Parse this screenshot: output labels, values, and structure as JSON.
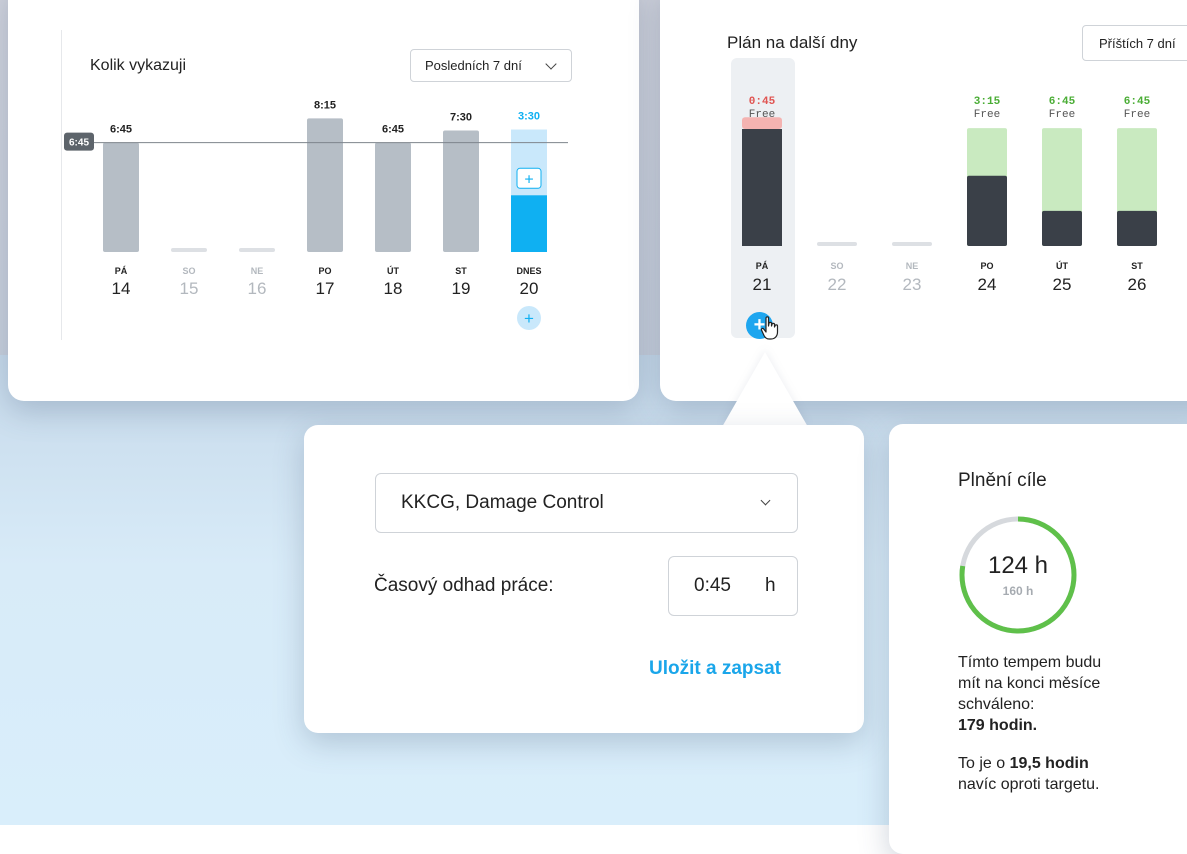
{
  "colors": {
    "bar_gray": "#b6bec6",
    "today_light": "#c9e8fb",
    "today_accent": "#0fb0f2",
    "dark_bar": "#3a4048",
    "free_green": "#c9eac0",
    "free_red": "#f4b3b1",
    "green_text": "#4aad35",
    "red_text": "#e05451",
    "link_blue": "#1aa6ea"
  },
  "left_panel": {
    "title": "Kolik vykazuji",
    "range_dropdown": "Posledních 7 dní",
    "target_label": "6:45",
    "today_add": "+"
  },
  "right_panel": {
    "title": "Plán na další dny",
    "range_dropdown": "Příštích 7 dní",
    "add_plus": "+"
  },
  "popup": {
    "project_select": "KKCG, Damage Control",
    "estimate_label": "Časový odhad práce:",
    "estimate_value": "0:45",
    "estimate_unit": "h",
    "save_link": "Uložit a zapsat"
  },
  "goal": {
    "title": "Plnění cíle",
    "current": "124 h",
    "target": "160 h",
    "progress_fraction": 0.775,
    "line1": "Tímto tempem budu",
    "line2": "mít na konci měsíce",
    "line3": "schváleno:",
    "line4": "179 hodin.",
    "line5_pre": "To je o ",
    "line5_bold": "19,5 hodin",
    "line6": "navíc oproti targetu."
  },
  "chart_data": [
    {
      "type": "bar",
      "title": "Kolik vykazuji",
      "categories": [
        "PÁ 14",
        "SO 15",
        "NE 16",
        "PO 17",
        "ÚT 18",
        "ST 19",
        "DNES 20"
      ],
      "days": [
        {
          "label": "PÁ",
          "num": "14",
          "value": "6:45",
          "weekend": false
        },
        {
          "label": "SO",
          "num": "15",
          "value": "",
          "weekend": true
        },
        {
          "label": "NE",
          "num": "16",
          "value": "",
          "weekend": true
        },
        {
          "label": "PO",
          "num": "17",
          "value": "8:15",
          "weekend": false
        },
        {
          "label": "ÚT",
          "num": "18",
          "value": "6:45",
          "weekend": false
        },
        {
          "label": "ST",
          "num": "19",
          "value": "7:30",
          "weekend": false
        },
        {
          "label": "DNES",
          "num": "20",
          "value": "3:30",
          "weekend": false,
          "today": true
        }
      ],
      "values_hours": [
        6.75,
        0,
        0,
        8.25,
        6.75,
        7.5,
        3.5
      ],
      "target_hours": 6.75
    },
    {
      "type": "bar",
      "title": "Plán na další dny",
      "categories": [
        "PÁ 21",
        "SO 22",
        "NE 23",
        "PO 24",
        "ÚT 25",
        "ST 26"
      ],
      "days": [
        {
          "label": "PÁ",
          "num": "21",
          "free": "0:45",
          "free_label": "Free",
          "over": true,
          "weekend": false
        },
        {
          "label": "SO",
          "num": "22",
          "free": "",
          "free_label": "",
          "weekend": true
        },
        {
          "label": "NE",
          "num": "23",
          "free": "",
          "free_label": "",
          "weekend": true
        },
        {
          "label": "PO",
          "num": "24",
          "free": "3:15",
          "free_label": "Free",
          "weekend": false
        },
        {
          "label": "ÚT",
          "num": "25",
          "free": "6:45",
          "free_label": "Free",
          "weekend": false
        },
        {
          "label": "ST",
          "num": "26",
          "free": "6:45",
          "free_label": "Free",
          "weekend": false
        }
      ],
      "planned_hours": [
        7.5,
        0,
        0,
        4.5,
        2.25,
        2.25
      ],
      "free_hours": [
        0.75,
        0,
        0,
        3.25,
        6.75,
        6.75
      ],
      "capacity_hours": 6.75
    }
  ]
}
